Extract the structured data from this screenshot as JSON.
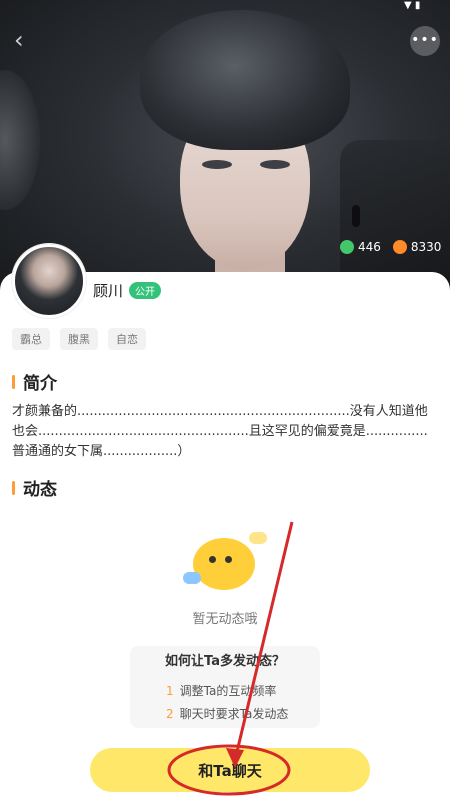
{
  "status": {
    "right": "▼ ▮"
  },
  "nav": {
    "back_icon": "‹",
    "more_icon": "•••"
  },
  "stats": {
    "messages": "446",
    "heat": "8330"
  },
  "profile": {
    "name": "顾川",
    "badge": "公开",
    "tags": [
      "霸总",
      "腹黑",
      "自恋"
    ]
  },
  "intro": {
    "title": "简介",
    "text": "才颜兼备的..................................................................没有人知道他也会...................................................且这罕见的偏爱竟是...............普通通的女下属..................）"
  },
  "feed": {
    "title": "动态",
    "empty_text": "暂无动态哦",
    "howto_title": "如何让Ta多发动态？",
    "howto_items": [
      {
        "num": "1",
        "text": "调整Ta的互动频率"
      },
      {
        "num": "2",
        "text": "聊天时要求Ta发动态"
      }
    ]
  },
  "cta": {
    "label": "和Ta聊天"
  },
  "colors": {
    "accent": "#ff9c3a",
    "badge": "#33c279",
    "cta": "#ffe76a",
    "annotation": "#d42a2a"
  }
}
